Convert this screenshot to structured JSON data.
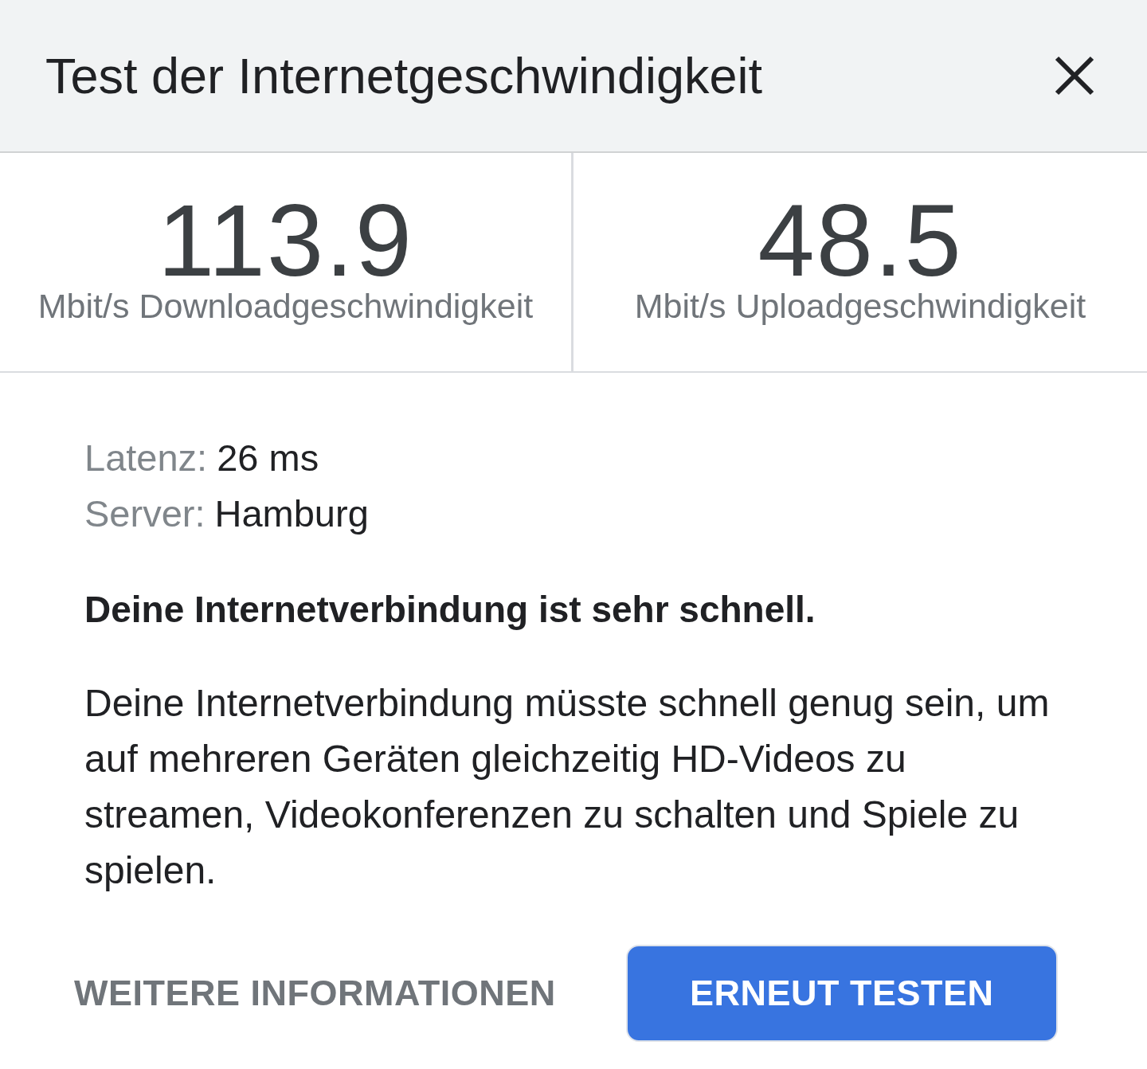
{
  "dialog": {
    "title": "Test der Internetgeschwindigkeit"
  },
  "metrics": [
    {
      "value": "113.9",
      "label": "Mbit/s Downloadgeschwindigkeit"
    },
    {
      "value": "48.5",
      "label": "Mbit/s Uploadgeschwindigkeit"
    }
  ],
  "details": [
    {
      "label": "Latenz:",
      "value": "26 ms"
    },
    {
      "label": "Server:",
      "value": "Hamburg"
    }
  ],
  "summary": "Deine Internetverbindung ist sehr schnell.",
  "description": "Deine Internetverbindung müsste schnell genug sein, um auf mehreren Geräten gleichzeitig HD-Videos zu streamen, Videokonferenzen zu schalten und Spiele zu spielen.",
  "buttons": [
    {
      "kind": "text",
      "label": "WEITERE INFORMATIONEN"
    },
    {
      "kind": "filled",
      "label": "ERNEUT TESTEN"
    }
  ]
}
